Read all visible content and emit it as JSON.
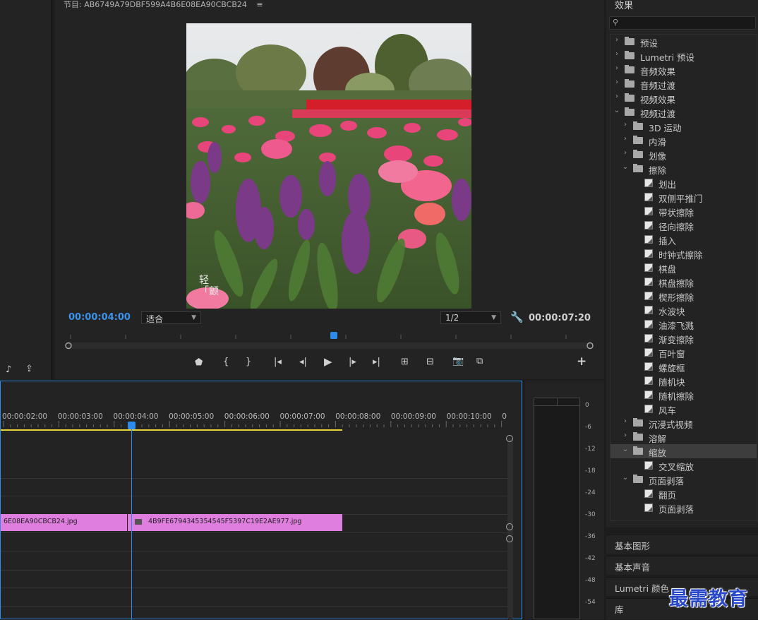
{
  "program_monitor": {
    "title": "节目: AB6749A79DBF599A4B6E08EA90CBCB24",
    "current_timecode": "00:00:04:00",
    "zoom": "适合",
    "resolution": "1/2",
    "duration_timecode": "00:00:07:20",
    "playhead_fraction": 0.51
  },
  "video_overlay_text": "轻\n「颤",
  "effects": {
    "title": "效果",
    "tree": [
      {
        "label": "预设",
        "indent": 0,
        "type": "folder-star",
        "expanded": false
      },
      {
        "label": "Lumetri 预设",
        "indent": 0,
        "type": "folder-star",
        "expanded": false
      },
      {
        "label": "音频效果",
        "indent": 0,
        "type": "folder",
        "expanded": false
      },
      {
        "label": "音频过渡",
        "indent": 0,
        "type": "folder",
        "expanded": false
      },
      {
        "label": "视频效果",
        "indent": 0,
        "type": "folder",
        "expanded": false
      },
      {
        "label": "视频过渡",
        "indent": 0,
        "type": "folder",
        "expanded": true
      },
      {
        "label": "3D 运动",
        "indent": 1,
        "type": "folder",
        "expanded": false
      },
      {
        "label": "内滑",
        "indent": 1,
        "type": "folder",
        "expanded": false
      },
      {
        "label": "划像",
        "indent": 1,
        "type": "folder",
        "expanded": false
      },
      {
        "label": "擦除",
        "indent": 1,
        "type": "folder",
        "expanded": true
      },
      {
        "label": "划出",
        "indent": 2,
        "type": "fx"
      },
      {
        "label": "双侧平推门",
        "indent": 2,
        "type": "fx"
      },
      {
        "label": "带状擦除",
        "indent": 2,
        "type": "fx"
      },
      {
        "label": "径向擦除",
        "indent": 2,
        "type": "fx"
      },
      {
        "label": "插入",
        "indent": 2,
        "type": "fx"
      },
      {
        "label": "时钟式擦除",
        "indent": 2,
        "type": "fx"
      },
      {
        "label": "棋盘",
        "indent": 2,
        "type": "fx"
      },
      {
        "label": "棋盘擦除",
        "indent": 2,
        "type": "fx"
      },
      {
        "label": "楔形擦除",
        "indent": 2,
        "type": "fx"
      },
      {
        "label": "水波块",
        "indent": 2,
        "type": "fx"
      },
      {
        "label": "油漆飞溅",
        "indent": 2,
        "type": "fx"
      },
      {
        "label": "渐变擦除",
        "indent": 2,
        "type": "fx"
      },
      {
        "label": "百叶窗",
        "indent": 2,
        "type": "fx"
      },
      {
        "label": "螺旋框",
        "indent": 2,
        "type": "fx"
      },
      {
        "label": "随机块",
        "indent": 2,
        "type": "fx"
      },
      {
        "label": "随机擦除",
        "indent": 2,
        "type": "fx"
      },
      {
        "label": "风车",
        "indent": 2,
        "type": "fx"
      },
      {
        "label": "沉浸式视频",
        "indent": 1,
        "type": "folder",
        "expanded": false
      },
      {
        "label": "溶解",
        "indent": 1,
        "type": "folder",
        "expanded": false
      },
      {
        "label": "缩放",
        "indent": 1,
        "type": "folder",
        "expanded": true,
        "selected": true
      },
      {
        "label": "交叉缩放",
        "indent": 2,
        "type": "fx"
      },
      {
        "label": "页面剥落",
        "indent": 1,
        "type": "folder",
        "expanded": true
      },
      {
        "label": "翻页",
        "indent": 2,
        "type": "fx"
      },
      {
        "label": "页面剥落",
        "indent": 2,
        "type": "fx"
      }
    ]
  },
  "side_tabs": {
    "basic_graphics": "基本图形",
    "basic_sound": "基本声音",
    "lumetri_color": "Lumetri 颜色",
    "library": "库"
  },
  "timeline": {
    "ruler_labels": [
      "00:00:02:00",
      "00:00:03:00",
      "00:00:04:00",
      "00:00:05:00",
      "00:00:06:00",
      "00:00:07:00",
      "00:00:08:00",
      "00:00:09:00",
      "00:00:10:00",
      "0"
    ],
    "clip1_label": "6E08EA90CBCB24.jpg",
    "clip2_label": "4B9FE6794345354545F5397C19E2AE977.jpg"
  },
  "audio_meter": {
    "db_labels": [
      "0",
      "-6",
      "-12",
      "-18",
      "-24",
      "-30",
      "-36",
      "-42",
      "-48",
      "-54"
    ]
  },
  "watermark": "最需教育",
  "colors": {
    "accent_blue": "#2d8ceb",
    "clip_pink": "#e07ee0",
    "timecode_blue": "#3b92ea",
    "work_area_yellow": "#e8d23a"
  }
}
